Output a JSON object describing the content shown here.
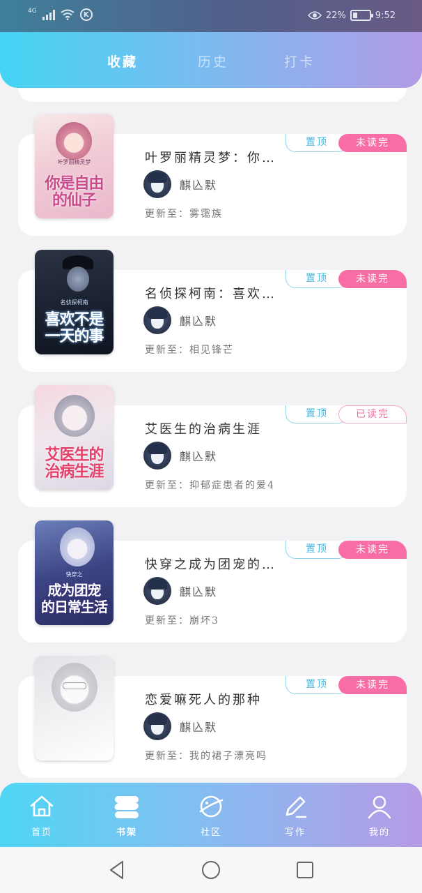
{
  "status_bar": {
    "network": "4G",
    "carrier_icon": "K",
    "battery": "22%",
    "battery_level": 0.22,
    "time": "9:52"
  },
  "top_tabs": [
    {
      "label": "收藏",
      "active": true
    },
    {
      "label": "历史",
      "active": false
    },
    {
      "label": "打卡",
      "active": false
    }
  ],
  "books": [
    {
      "title": "叶罗丽精灵梦：你…",
      "author": "麒兦默",
      "update": "更新至：雾霭族",
      "pin_label": "置顶",
      "read_label": "未读完",
      "read_state": "unread",
      "cover": {
        "title_line1": "你是自由",
        "title_line2": "的仙子",
        "subtitle": "叶罗丽精灵梦",
        "bg": "#f6dfe4",
        "accent": "#c84a8a"
      }
    },
    {
      "title": "名侦探柯南：喜欢…",
      "author": "麒兦默",
      "update": "更新至：相见锋芒",
      "pin_label": "置顶",
      "read_label": "未读完",
      "read_state": "unread",
      "cover": {
        "title_line1": "喜欢不是",
        "title_line2": "一天的事",
        "subtitle": "名侦探柯南",
        "bg": "#1e2634",
        "accent": "#ffffff"
      }
    },
    {
      "title": "艾医生的治病生涯",
      "author": "麒兦默",
      "update": "更新至：抑郁症患者的爱4",
      "pin_label": "置顶",
      "read_label": "已读完",
      "read_state": "done",
      "cover": {
        "title_line1": "艾医生的",
        "title_line2": "治病生涯",
        "subtitle": "",
        "bg": "#f3e6ea",
        "accent": "#e4406a"
      }
    },
    {
      "title": "快穿之成为团宠的…",
      "author": "麒兦默",
      "update": "更新至：崩坏3",
      "pin_label": "置顶",
      "read_label": "未读完",
      "read_state": "unread",
      "cover": {
        "title_line1": "成为团宠",
        "title_line2": "的日常生活",
        "subtitle": "快穿之",
        "bg": "#3a3f78",
        "accent": "#ffffff"
      }
    },
    {
      "title": "恋爱嘛死人的那种",
      "author": "麒兦默",
      "update": "更新至：我的裙子漂亮吗",
      "pin_label": "置顶",
      "read_label": "未读完",
      "read_state": "unread",
      "cover": {
        "title_line1": "",
        "title_line2": "",
        "subtitle": "",
        "bg": "#ecebee",
        "accent": "#999999"
      }
    }
  ],
  "bottom_nav": [
    {
      "label": "首页",
      "icon": "home-icon",
      "active": false
    },
    {
      "label": "书架",
      "icon": "bookshelf-icon",
      "active": true
    },
    {
      "label": "社区",
      "icon": "planet-icon",
      "active": false
    },
    {
      "label": "写作",
      "icon": "pen-icon",
      "active": false
    },
    {
      "label": "我的",
      "icon": "user-icon",
      "active": false
    }
  ],
  "colors": {
    "gradient_start": "#44d4f3",
    "gradient_end": "#b39be6",
    "unread_pink": "#f86ea4",
    "pin_blue": "#45b6de"
  }
}
